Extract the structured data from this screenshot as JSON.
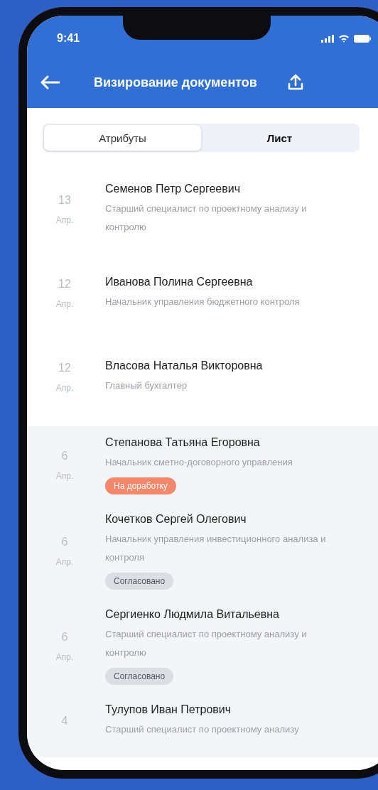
{
  "status_bar": {
    "time": "9:41"
  },
  "header": {
    "title": "Визирование документов"
  },
  "tabs": [
    {
      "label": "Атрибуты",
      "selected": false
    },
    {
      "label": "Лист",
      "selected": true
    }
  ],
  "sections": [
    {
      "kind": "plain",
      "entries": [
        {
          "day": "13",
          "month": "Апр.",
          "name": "Семенов Петр Сергеевич",
          "position": "Старший специалист по проектному анализу и контролю"
        },
        {
          "day": "12",
          "month": "Апр.",
          "name": "Иванова Полина Сергеевна",
          "position": "Начальник управления бюджетного контроля"
        },
        {
          "day": "12",
          "month": "Апр.",
          "name": "Власова Наталья Викторовна",
          "position": "Главный бухгалтер"
        }
      ]
    },
    {
      "kind": "shaded",
      "entries": [
        {
          "day": "6",
          "month": "Апр.",
          "name": "Степанова Татьяна Егоровна",
          "position": "Начальник сметно-договорного управления",
          "badge": {
            "kind": "rework",
            "label": "На доработку",
            "color": "#f4876a"
          }
        },
        {
          "day": "6",
          "month": "Апр.",
          "name": "Кочетков Сергей Олегович",
          "position": "Начальник управления инвестиционного анализа и контроля",
          "badge": {
            "kind": "approved",
            "label": "Согласовано",
            "color": "#dcdee3"
          }
        },
        {
          "day": "6",
          "month": "Апр.",
          "name": "Сергиенко Людмила Витальевна",
          "position": "Старший специалист по проектному анализу и контролю",
          "badge": {
            "kind": "approved",
            "label": "Согласовано",
            "color": "#dcdee3"
          }
        },
        {
          "day": "4",
          "name": "Тулупов Иван Петрович",
          "position": "Старший специалист по проектному анализу"
        }
      ]
    }
  ]
}
